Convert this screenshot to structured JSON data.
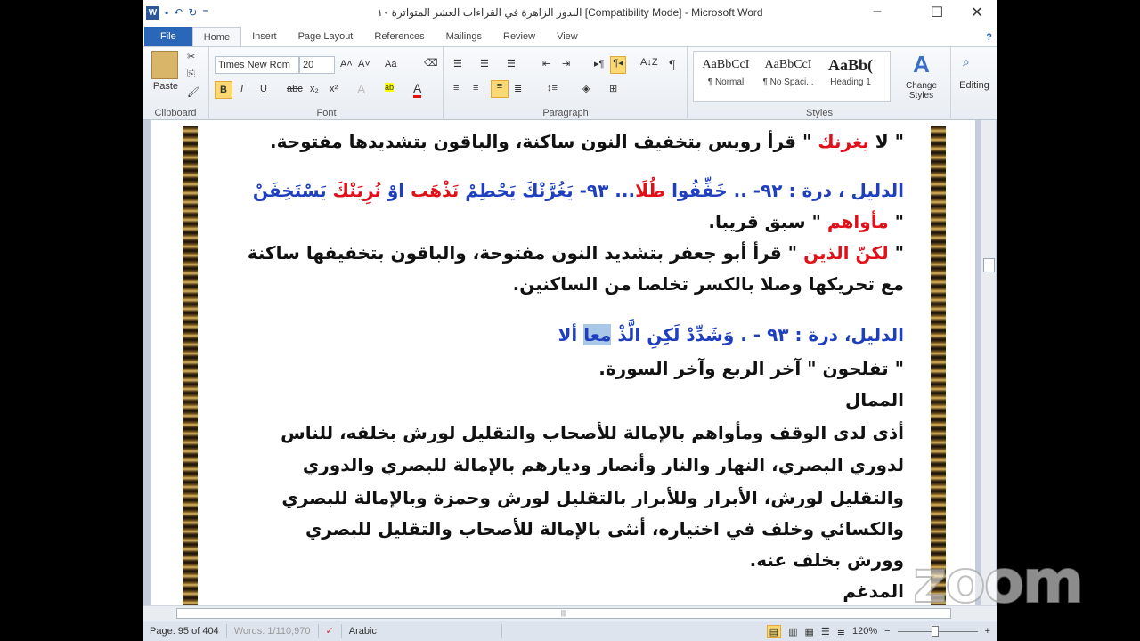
{
  "window": {
    "title": "البدور الزاهرة في القراءات العشر المتواترة ١٠ [Compatibility Mode] - Microsoft Word",
    "minimize": "–",
    "maximize": "☐",
    "close": "✕"
  },
  "quick_access": {
    "word": "W",
    "save": "💾",
    "undo": "↶",
    "redo": "↻",
    "customize": "⁼"
  },
  "tabs": [
    "File",
    "Home",
    "Insert",
    "Page Layout",
    "References",
    "Mailings",
    "Review",
    "View"
  ],
  "ribbon": {
    "clipboard": {
      "label": "Clipboard",
      "paste": "Paste"
    },
    "font": {
      "label": "Font",
      "name": "Times New Rom",
      "size": "20",
      "grow": "A˄",
      "shrink": "A˅",
      "case": "Aa",
      "bold": "B",
      "italic": "I",
      "underline": "U",
      "strike": "abc",
      "sub": "x₂",
      "sup": "x²",
      "highlight": "ab",
      "color": "A"
    },
    "paragraph": {
      "label": "Paragraph",
      "pilcrow": "¶",
      "sort": "A↓Z"
    },
    "styles": {
      "label": "Styles",
      "items": [
        {
          "sample": "AaBbCcI",
          "name": "¶ Normal"
        },
        {
          "sample": "AaBbCcI",
          "name": "¶ No Spaci..."
        },
        {
          "sample": "AaBb(",
          "name": "Heading 1"
        }
      ],
      "change": "Change Styles"
    },
    "editing": {
      "label": "Editing"
    }
  },
  "colors": {
    "red": "#e0101a",
    "blue": "#1f3fbf",
    "black": "#111111"
  },
  "document": {
    "lines": [
      [
        {
          "t": "\" لا ",
          "c": "black"
        },
        {
          "t": "يغرنك",
          "c": "red"
        },
        {
          "t": " \" قرأ رويس بتخفيف النون ساكنة، والباقون بتشديدها مفتوحة.",
          "c": "black"
        }
      ],
      [
        {
          "t": "الدليل ، درة : ٩٢- .. خَفِّفُوا ",
          "c": "blue"
        },
        {
          "t": "طُلَا",
          "c": "red"
        },
        {
          "t": "...   ٩٣- يَغُرَّنْكَ يَحْطِمْ ",
          "c": "blue"
        },
        {
          "t": "نَذْهَب",
          "c": "red"
        },
        {
          "t": " اوْ ",
          "c": "blue"
        },
        {
          "t": "نُرِيَنْكَ",
          "c": "red"
        },
        {
          "t": " يَسْتَخِفَنْ",
          "c": "blue"
        }
      ],
      [
        {
          "t": "\" ",
          "c": "black"
        },
        {
          "t": "مأواهم",
          "c": "red"
        },
        {
          "t": " \" سبق قريبا.",
          "c": "black"
        }
      ],
      [
        {
          "t": "\" ",
          "c": "black"
        },
        {
          "t": "لكنّ الذين",
          "c": "red"
        },
        {
          "t": " \" قرأ أبو جعفر بتشديد النون مفتوحة، والباقون بتخفيفها ساكنة",
          "c": "black"
        }
      ],
      [
        {
          "t": "مع تحريكها وصلا بالكسر تخلصا من الساكنين.",
          "c": "black"
        }
      ],
      [
        {
          "t": "الدليل، درة : ٩٣ - . وَشَدِّدْ لَكِنِ الَّذْ ",
          "c": "blue"
        },
        {
          "t": "معا",
          "c": "blue",
          "mark": true
        },
        {
          "t": " ألا",
          "c": "blue"
        }
      ],
      [
        {
          "t": "\" تفلحون \" آخر الربع وآخر السورة.",
          "c": "black"
        }
      ],
      [
        {
          "t": "الممال",
          "c": "black"
        }
      ],
      [
        {
          "t": "أذى لدى الوقف ومأواهم بالإمالة للأصحاب والتقليل لورش بخلفه، للناس",
          "c": "black"
        }
      ],
      [
        {
          "t": "لدوري البصري، النهار والنار وأنصار وديارهم بالإمالة للبصري والدوري",
          "c": "black"
        }
      ],
      [
        {
          "t": "والتقليل لورش، الأبرار وللأبرار بالتقليل لورش وحمزة وبالإمالة للبصري",
          "c": "black"
        }
      ],
      [
        {
          "t": "والكسائي وخلف في اختياره، أنثى بالإمالة للأصحاب والتقليل للبصري",
          "c": "black"
        }
      ],
      [
        {
          "t": "وورش بخلف عنه.",
          "c": "black"
        }
      ],
      [
        {
          "t": "المدغم",
          "c": "black"
        }
      ]
    ]
  },
  "status": {
    "page": "Page: 95 of 404",
    "words": "Words: 1/110,970",
    "language": "Arabic",
    "zoom": "120%",
    "zoom_out": "−",
    "zoom_in": "+"
  },
  "watermark": "zoom"
}
